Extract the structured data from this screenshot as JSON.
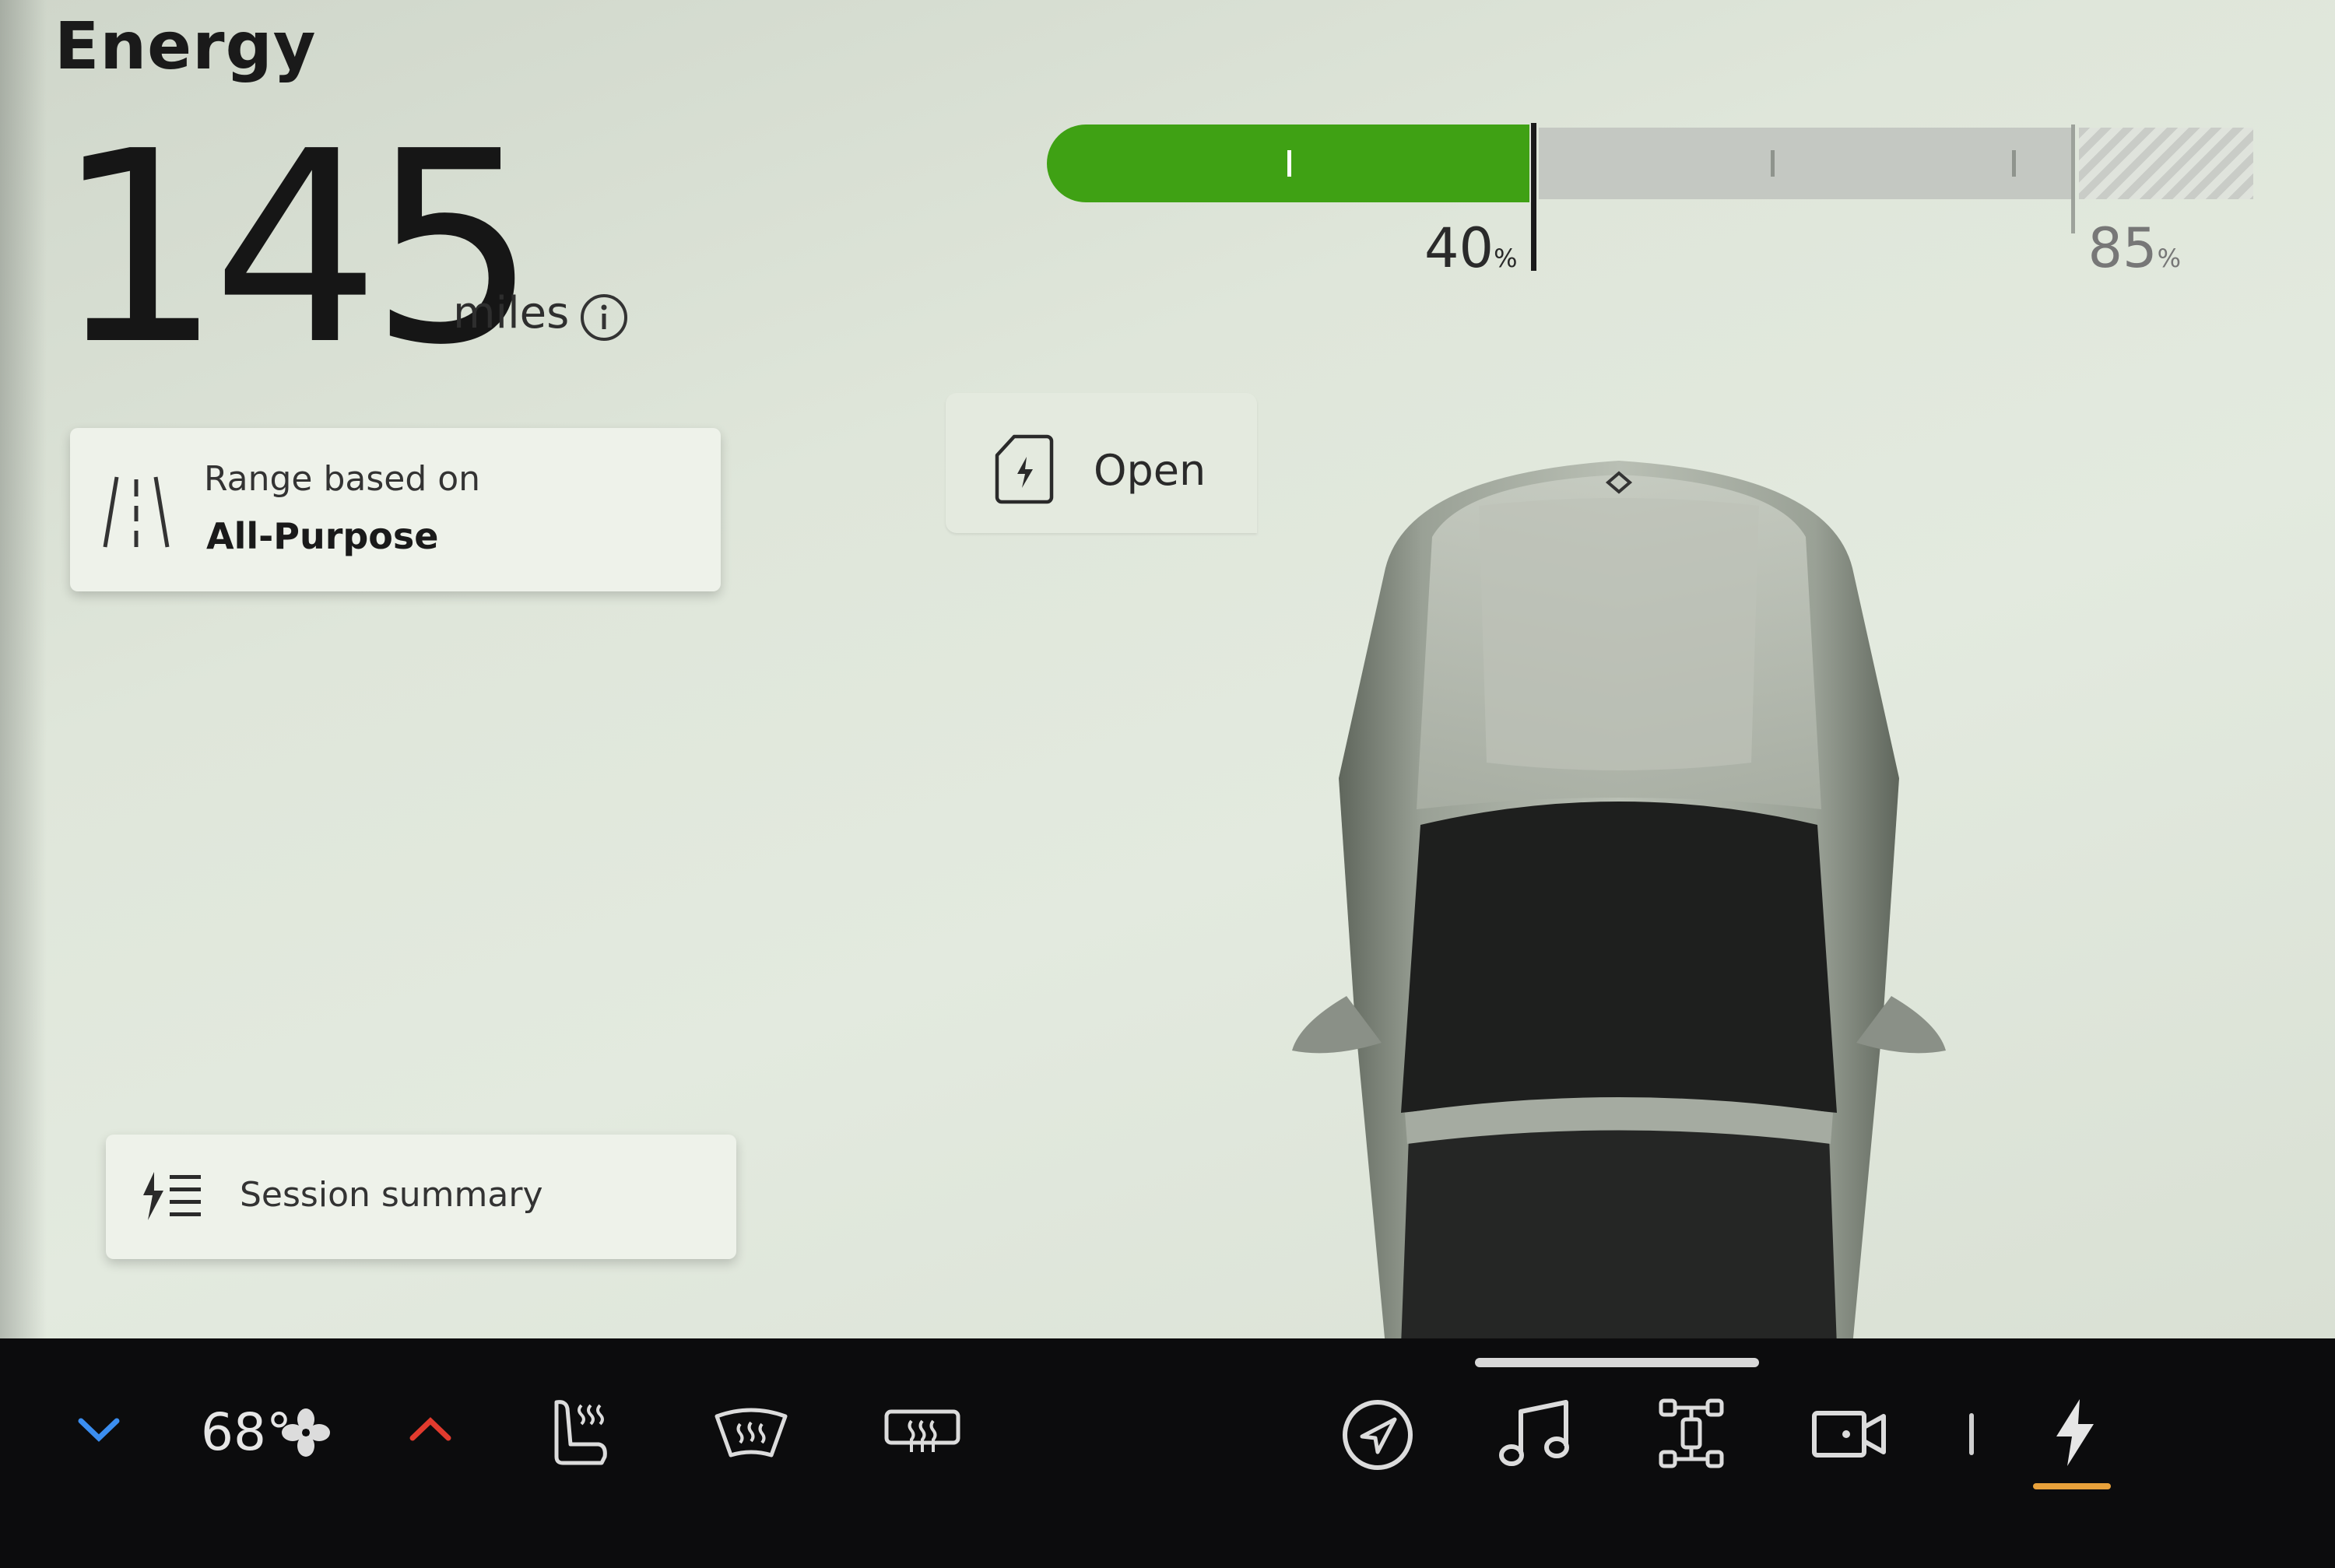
{
  "screen": {
    "title": "Energy",
    "range": {
      "value": "145",
      "unit": "miles"
    },
    "range_card": {
      "label": "Range based on",
      "value": "All-Purpose"
    },
    "battery": {
      "current_percent": 40,
      "current_label": "40",
      "limit_percent": 85,
      "limit_label": "85",
      "percent_symbol": "%",
      "fill_color": "#3fa114"
    },
    "charge_port": {
      "status": "Open"
    },
    "session_card": {
      "label": "Session summary"
    }
  },
  "bottom_bar": {
    "temperature": "68°",
    "icons": [
      "temp-down-icon",
      "fan-icon",
      "temp-up-icon",
      "seat-heat-icon",
      "front-defrost-icon",
      "rear-defrost-icon",
      "navigation-icon",
      "music-icon",
      "vehicle-icon",
      "camera-icon",
      "energy-icon"
    ],
    "accent_color": "#e8a13b",
    "temp_down_color": "#3b8ef0",
    "temp_up_color": "#e23b2e"
  }
}
